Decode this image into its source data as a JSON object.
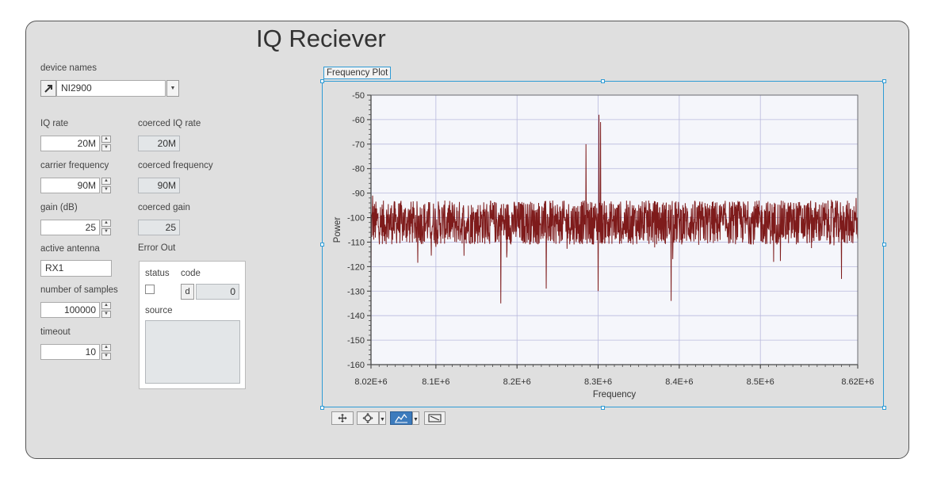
{
  "window": {
    "title": "IQ Reciever"
  },
  "device": {
    "label": "device names",
    "value": "NI2900"
  },
  "controls": {
    "iq_rate": {
      "label": "IQ rate",
      "value": "20M"
    },
    "carrier_frequency": {
      "label": "carrier frequency",
      "value": "90M"
    },
    "gain": {
      "label": "gain (dB)",
      "value": "25"
    },
    "active_antenna": {
      "label": "active antenna",
      "value": "RX1"
    },
    "number_of_samples": {
      "label": "number of samples",
      "value": "100000"
    },
    "timeout": {
      "label": "timeout",
      "value": "10"
    }
  },
  "indicators": {
    "coerced_iq_rate": {
      "label": "coerced IQ rate",
      "value": "20M"
    },
    "coerced_frequency": {
      "label": "coerced frequency",
      "value": "90M"
    },
    "coerced_gain": {
      "label": "coerced gain",
      "value": "25"
    }
  },
  "error_out": {
    "label": "Error Out",
    "status_label": "status",
    "code_label": "code",
    "code_value": "0",
    "code_radix": "d",
    "source_label": "source",
    "source_value": ""
  },
  "plot_toolbar": {
    "icons": [
      "cursor-move-icon",
      "zoom-icon",
      "pan-icon",
      "magnifier-icon"
    ]
  },
  "chart_data": {
    "type": "line",
    "title": "Frequency Plot",
    "xlabel": "Frequency",
    "ylabel": "Power",
    "xlim": [
      8020000,
      8620000
    ],
    "ylim": [
      -160,
      -50
    ],
    "x_ticks": [
      8020000,
      8100000,
      8200000,
      8300000,
      8400000,
      8500000,
      8620000
    ],
    "x_tick_labels": [
      "8.02E+6",
      "8.1E+6",
      "8.2E+6",
      "8.3E+6",
      "8.4E+6",
      "8.5E+6",
      "8.62E+6"
    ],
    "y_ticks": [
      -50,
      -60,
      -70,
      -80,
      -90,
      -100,
      -110,
      -120,
      -130,
      -140,
      -150,
      -160
    ],
    "y_tick_labels": [
      "-50",
      "-60",
      "-70",
      "-80",
      "-90",
      "-100",
      "-110",
      "-120",
      "-130",
      "-140",
      "-150",
      "-160"
    ],
    "grid": true,
    "line_color": "#7e1b1b",
    "series": [
      {
        "noise_floor": -102,
        "noise_spread": 9,
        "x": [
          8020000,
          8022000,
          8180000,
          8236000,
          8285000,
          8300000,
          8301000,
          8303000,
          8390000,
          8600000,
          8618000
        ],
        "y": [
          -126,
          -91,
          -135,
          -129,
          -70,
          -130,
          -58,
          -61,
          -134,
          -125,
          -92
        ]
      }
    ]
  }
}
